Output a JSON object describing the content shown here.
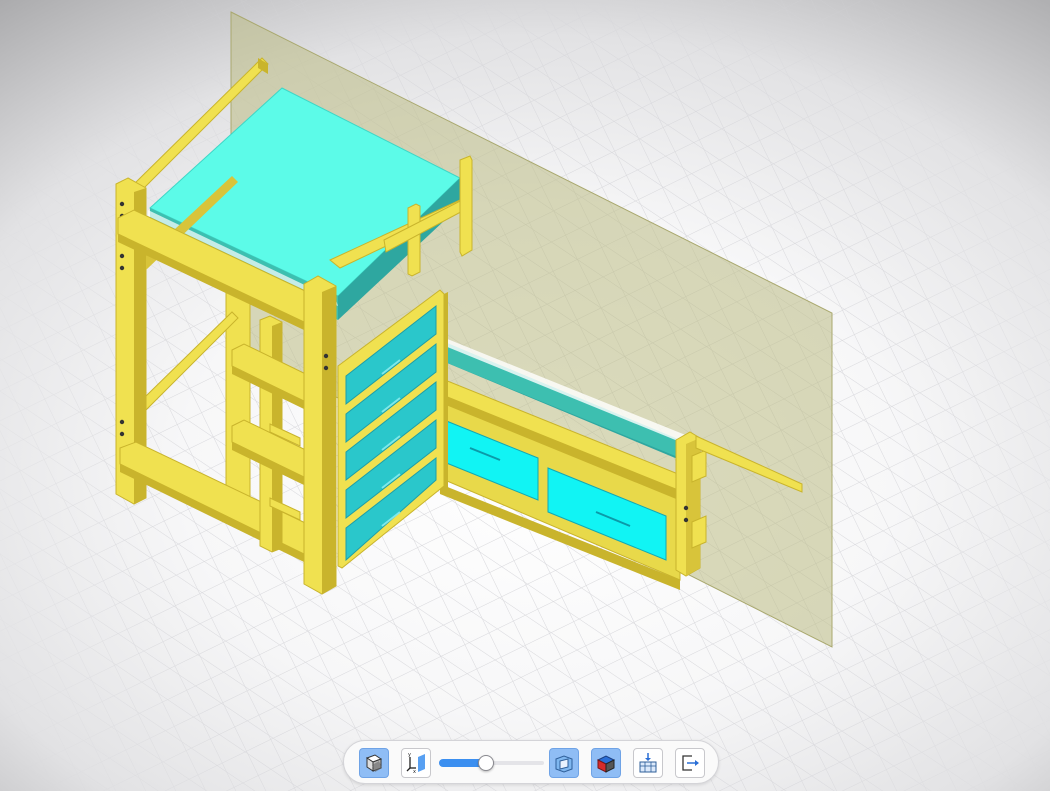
{
  "scene": {
    "model": "loft-bed-with-desk-and-drawers",
    "colors": {
      "frame": "#f0e150",
      "frame_dark": "#c9b42c",
      "mattress": "#5cfbe8",
      "drawer_front": "#2ac7cb",
      "drawer_light": "#11f4f4",
      "wall_plane": "#bcbb83",
      "grid_line": "#d9d9dd"
    }
  },
  "toolbar": {
    "view_cube_icon": "view-cube-icon",
    "axes_icon": "axes-section-icon",
    "slider": {
      "value": 0.45
    },
    "section_view_icon": "section-view-icon",
    "solid_view_icon": "solid-view-icon",
    "explode_icon": "explode-view-icon",
    "exit_icon": "exit-icon",
    "axis_labels": {
      "x": "x",
      "y": "y"
    }
  }
}
